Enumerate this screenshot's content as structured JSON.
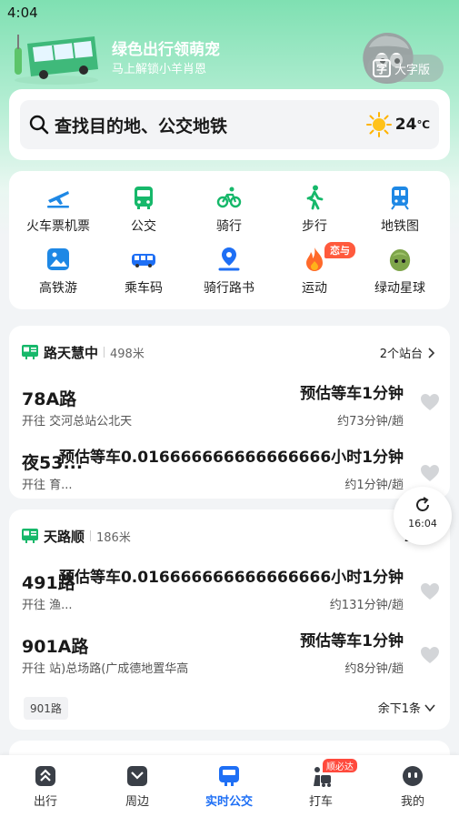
{
  "status_bar": {
    "time": "4:04"
  },
  "banner": {
    "title": "绿色出行领萌宠",
    "subtitle": "马上解锁小羊肖恩",
    "big_font_label": "大字版",
    "big_font_glyph": "字"
  },
  "search": {
    "placeholder": "查找目的地、公交地铁",
    "weather_temp": "24",
    "weather_unit": "℃"
  },
  "services": [
    {
      "label": "火车票机票",
      "icon": "plane-train-icon",
      "color": "#1e88e5"
    },
    {
      "label": "公交",
      "icon": "bus-icon",
      "color": "#16b86a"
    },
    {
      "label": "骑行",
      "icon": "bike-icon",
      "color": "#16b86a"
    },
    {
      "label": "步行",
      "icon": "walk-icon",
      "color": "#16b86a"
    },
    {
      "label": "地铁图",
      "icon": "subway-icon",
      "color": "#1e88e5"
    },
    {
      "label": "高铁游",
      "icon": "photo-icon",
      "color": "#1e88e5"
    },
    {
      "label": "乘车码",
      "icon": "bus-code-icon",
      "color": "#1e6ff5"
    },
    {
      "label": "骑行路书",
      "icon": "route-pin-icon",
      "color": "#1e6ff5"
    },
    {
      "label": "运动",
      "icon": "flame-icon",
      "color": "#ff6a2a",
      "badge": "恋与"
    },
    {
      "label": "绿动星球",
      "icon": "planet-mascot-icon",
      "color": "#6a9b3c"
    }
  ],
  "stops": [
    {
      "name": "路天慧中",
      "distance": "498米",
      "station_count": "2个站台",
      "routes": [
        {
          "name": "78A路",
          "eta": "预估等车1分钟",
          "direction": "开往 交河总站公北天",
          "trip": "约73分钟/趟"
        },
        {
          "name": "夜53...",
          "eta": "预估等车0.016666666666666666小时1分钟",
          "direction": "开往 育...",
          "trip": "约1分钟/趟"
        }
      ]
    },
    {
      "name": "天路顺",
      "distance": "186米",
      "station_count": "2个站",
      "routes": [
        {
          "name": "491路",
          "eta": "预估等车0.016666666666666666小时1分钟",
          "direction": "开往 渔...",
          "trip": "约131分钟/趟"
        },
        {
          "name": "901A路",
          "eta": "预估等车1分钟",
          "direction": "开往 站)总场路(广成德地置华高",
          "trip": "约8分钟/趟"
        }
      ],
      "chip": "901路",
      "more": "余下1条"
    }
  ],
  "refresh": {
    "time": "16:04"
  },
  "tabs": [
    {
      "label": "出行",
      "icon": "travel-icon"
    },
    {
      "label": "周边",
      "icon": "nearby-icon"
    },
    {
      "label": "实时公交",
      "icon": "realtime-bus-icon",
      "active": true
    },
    {
      "label": "打车",
      "icon": "taxi-icon",
      "badge": "顺必达"
    },
    {
      "label": "我的",
      "icon": "profile-icon"
    }
  ],
  "colors": {
    "accent": "#1e6ff5",
    "green": "#16b86a",
    "hot": "#ff5a3d"
  }
}
